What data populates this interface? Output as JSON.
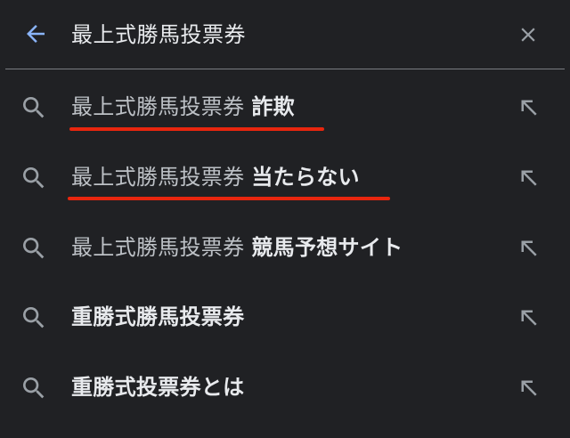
{
  "search": {
    "query": "最上式勝馬投票券"
  },
  "icons": {
    "back": "back-arrow-icon",
    "clear": "close-icon",
    "search": "search-icon",
    "fill": "arrow-up-left-icon"
  },
  "colors": {
    "background": "#202124",
    "text_primary": "#e8eaed",
    "text_secondary": "#bdc1c6",
    "accent_blue": "#8ab4f8",
    "annotation_red": "#e8260e"
  },
  "suggestions": [
    {
      "base": "最上式勝馬投票券 ",
      "bold": "詐欺",
      "underlined": true
    },
    {
      "base": "最上式勝馬投票券 ",
      "bold": "当たらない",
      "underlined": true
    },
    {
      "base": "最上式勝馬投票券 ",
      "bold": "競馬予想サイト",
      "underlined": false
    },
    {
      "base": "",
      "bold": "重勝式勝馬投票券",
      "underlined": false
    },
    {
      "base": "",
      "bold": "重勝式投票券とは",
      "underlined": false
    }
  ]
}
